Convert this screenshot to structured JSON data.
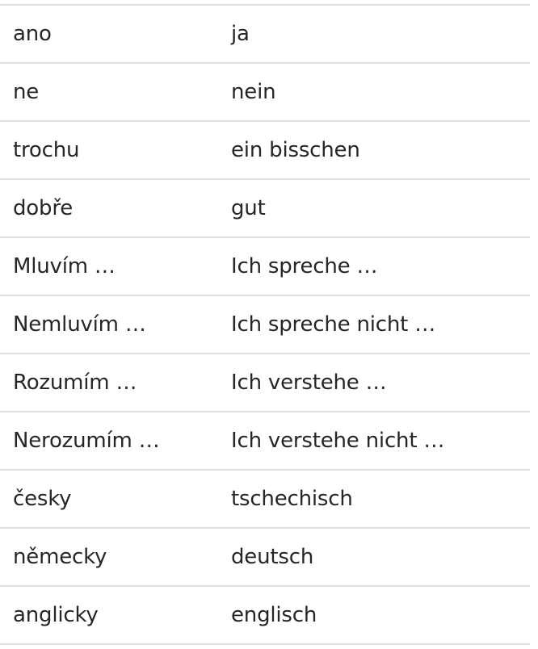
{
  "vocabulary": [
    {
      "cs": "ano",
      "de": "ja"
    },
    {
      "cs": "ne",
      "de": "nein"
    },
    {
      "cs": "trochu",
      "de": "ein bisschen"
    },
    {
      "cs": "dobře",
      "de": "gut"
    },
    {
      "cs": "Mluvím …",
      "de": "Ich spreche …"
    },
    {
      "cs": "Nemluvím …",
      "de": "Ich spreche nicht …"
    },
    {
      "cs": "Rozumím …",
      "de": "Ich verstehe …"
    },
    {
      "cs": "Nerozumím …",
      "de": "Ich verstehe nicht …"
    },
    {
      "cs": "česky",
      "de": "tschechisch"
    },
    {
      "cs": "německy",
      "de": "deutsch"
    },
    {
      "cs": "anglicky",
      "de": "englisch"
    }
  ],
  "colors": {
    "text": "#262626",
    "divider": "#dedede",
    "background": "#ffffff"
  }
}
